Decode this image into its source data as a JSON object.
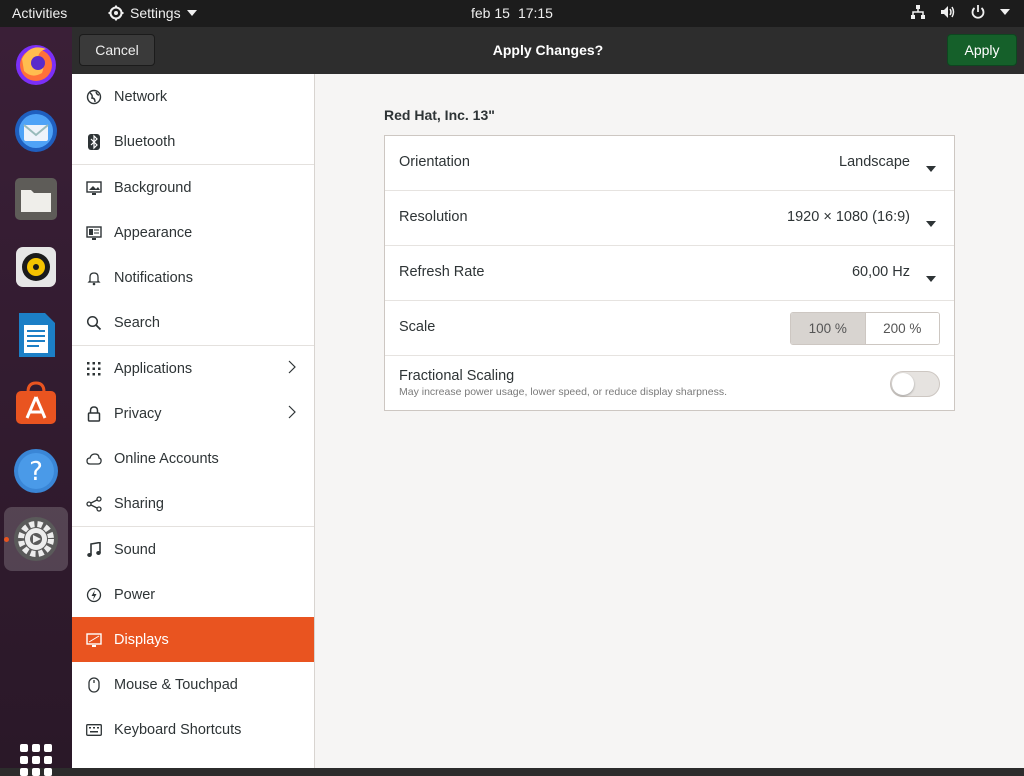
{
  "topbar": {
    "activities": "Activities",
    "app_menu": "Settings",
    "date": "feb 15",
    "time": "17:15",
    "tray_icons": [
      "network-icon",
      "volume-icon",
      "power-icon",
      "chevron-down-icon"
    ]
  },
  "dock": {
    "apps": [
      {
        "name": "firefox",
        "icon": "firefox-icon"
      },
      {
        "name": "thunderbird",
        "icon": "thunderbird-icon"
      },
      {
        "name": "files",
        "icon": "files-icon"
      },
      {
        "name": "rhythmbox",
        "icon": "rhythmbox-icon"
      },
      {
        "name": "libreoffice-writer",
        "icon": "writer-icon"
      },
      {
        "name": "ubuntu-software",
        "icon": "software-icon"
      },
      {
        "name": "help",
        "icon": "help-icon"
      },
      {
        "name": "settings",
        "icon": "settings-icon",
        "active": true
      }
    ],
    "show_apps_icon": "app-grid-icon"
  },
  "header": {
    "cancel_label": "Cancel",
    "title": "Apply Changes?",
    "apply_label": "Apply",
    "apply_color": "#15602a"
  },
  "sidebar": {
    "accent_color": "#e95420",
    "items": [
      {
        "label": "Network",
        "icon": "network-globe-icon"
      },
      {
        "label": "Bluetooth",
        "icon": "bluetooth-icon"
      },
      {
        "label": "Background",
        "icon": "background-icon"
      },
      {
        "label": "Appearance",
        "icon": "appearance-icon"
      },
      {
        "label": "Notifications",
        "icon": "bell-icon"
      },
      {
        "label": "Search",
        "icon": "search-icon"
      },
      {
        "label": "Applications",
        "icon": "apps-grid-icon",
        "has_submenu": true
      },
      {
        "label": "Privacy",
        "icon": "lock-icon",
        "has_submenu": true
      },
      {
        "label": "Online Accounts",
        "icon": "cloud-icon"
      },
      {
        "label": "Sharing",
        "icon": "share-icon"
      },
      {
        "label": "Sound",
        "icon": "music-note-icon"
      },
      {
        "label": "Power",
        "icon": "power-icon"
      },
      {
        "label": "Displays",
        "icon": "display-icon",
        "selected": true
      },
      {
        "label": "Mouse & Touchpad",
        "icon": "mouse-icon"
      },
      {
        "label": "Keyboard Shortcuts",
        "icon": "keyboard-icon"
      }
    ]
  },
  "main": {
    "display_name": "Red Hat, Inc. 13\"",
    "orientation": {
      "label": "Orientation",
      "value": "Landscape"
    },
    "resolution": {
      "label": "Resolution",
      "value": "1920 × 1080 (16:9)"
    },
    "refresh_rate": {
      "label": "Refresh Rate",
      "value": "60,00 Hz"
    },
    "scale": {
      "label": "Scale",
      "options": [
        "100 %",
        "200 %"
      ],
      "selected": "100 %"
    },
    "fractional_scaling": {
      "label": "Fractional Scaling",
      "description": "May increase power usage, lower speed, or reduce display sharpness.",
      "enabled": false
    }
  }
}
